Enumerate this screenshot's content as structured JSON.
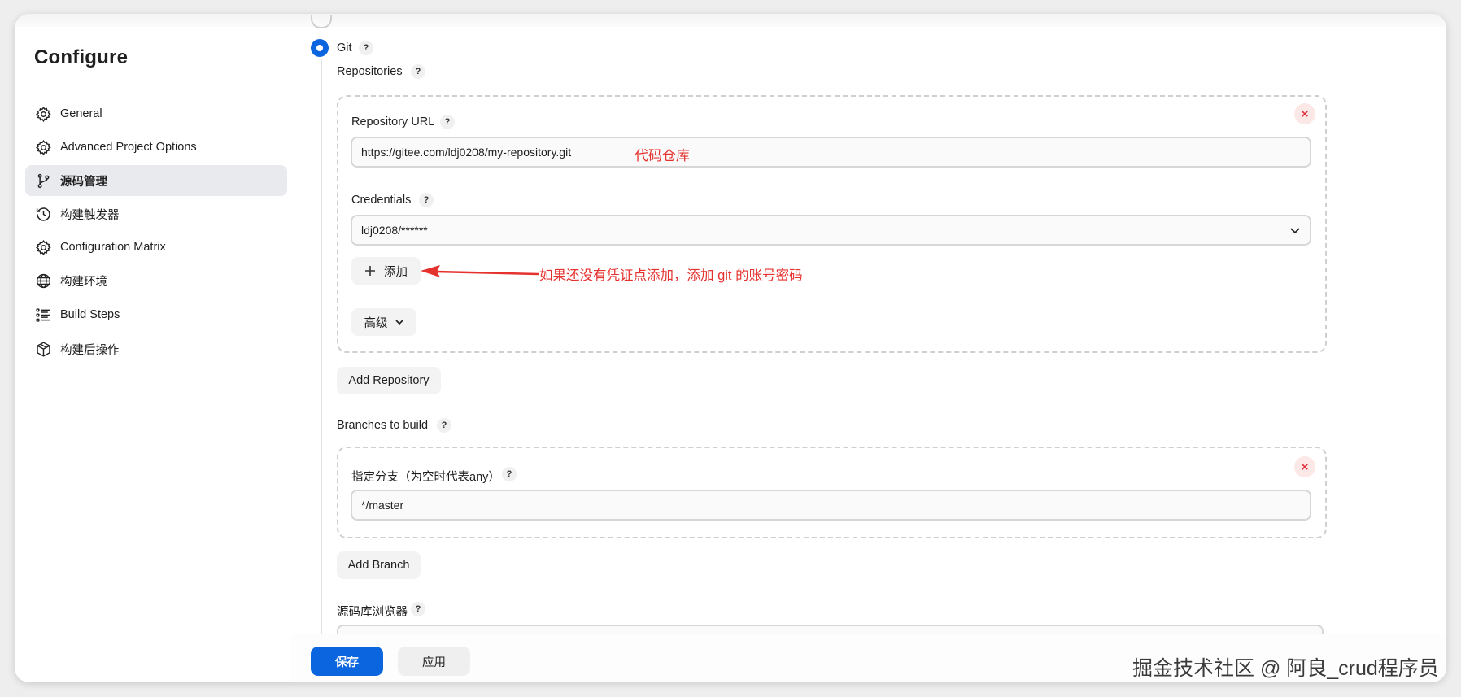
{
  "sidebar": {
    "title": "Configure",
    "items": [
      {
        "label": "General",
        "icon": "gear-icon"
      },
      {
        "label": "Advanced Project Options",
        "icon": "gear-icon"
      },
      {
        "label": "源码管理",
        "icon": "branch-icon",
        "active": true
      },
      {
        "label": "构建触发器",
        "icon": "clock-icon"
      },
      {
        "label": "Configuration Matrix",
        "icon": "gear-icon"
      },
      {
        "label": "构建环境",
        "icon": "globe-icon"
      },
      {
        "label": "Build Steps",
        "icon": "list-icon"
      },
      {
        "label": "构建后操作",
        "icon": "package-icon"
      }
    ]
  },
  "scm": {
    "option_label": "Git",
    "help": "?",
    "repositories_label": "Repositories",
    "repo_url_label": "Repository URL",
    "repo_url_value": "https://gitee.com/ldj0208/my-repository.git",
    "credentials_label": "Credentials",
    "credentials_value": "ldj0208/******",
    "add_button": "添加",
    "advanced_button": "高级",
    "add_repository_button": "Add Repository",
    "branches_label": "Branches to build",
    "branch_specifier_label": "指定分支（为空时代表any）",
    "branch_value": "*/master",
    "add_branch_button": "Add Branch",
    "repo_browser_label": "源码库浏览器",
    "delete_symbol": "×"
  },
  "annotations": {
    "repo_note": "代码仓库",
    "add_note": "如果还没有凭证点添加，添加 git 的账号密码"
  },
  "footer": {
    "save": "保存",
    "apply": "应用"
  },
  "watermark": "掘金技术社区 @ 阿良_crud程序员",
  "colors": {
    "primary": "#0b65de",
    "annotation": "#e5322e",
    "delete": "#e0303a"
  }
}
